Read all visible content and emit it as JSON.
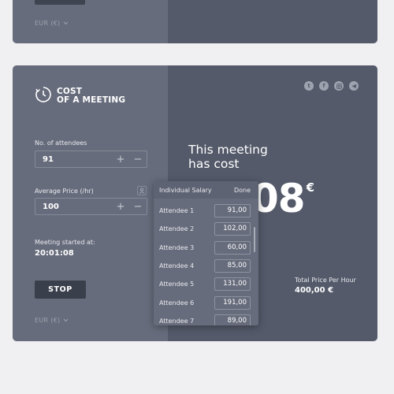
{
  "top_card": {
    "currency_label": "EUR (€)"
  },
  "logo": {
    "line1": "COST",
    "line2": "OF A MEETING"
  },
  "attendees": {
    "label": "No. of attendees",
    "value": "91",
    "plus": "+",
    "minus": "−"
  },
  "avg_price": {
    "label": "Average Price (/hr)",
    "value": "100",
    "plus": "+",
    "minus": "−"
  },
  "meeting": {
    "started_label": "Meeting started at:",
    "started_time": "20:01:08"
  },
  "stop_label": "STOP",
  "currency_label": "EUR (€)",
  "socials": [
    "twitter-icon",
    "facebook-icon",
    "instagram-icon",
    "telegram-icon"
  ],
  "result": {
    "headline_line1": "This meeting",
    "headline_line2": "has cost",
    "amount": ",08",
    "currency_symbol": "€",
    "total_price_label": "Total Price Per Hour",
    "total_price_value": "400,00 €"
  },
  "salary_popup": {
    "title": "Individual Salary",
    "done": "Done",
    "rows": [
      {
        "label": "Attendee 1",
        "value": "91,00"
      },
      {
        "label": "Attendee 2",
        "value": "102,00"
      },
      {
        "label": "Attendee 3",
        "value": "60,00"
      },
      {
        "label": "Attendee 4",
        "value": "85,00"
      },
      {
        "label": "Attendee 5",
        "value": "131,00"
      },
      {
        "label": "Attendee 6",
        "value": "191,00"
      },
      {
        "label": "Attendee 7",
        "value": "89,00"
      }
    ]
  }
}
